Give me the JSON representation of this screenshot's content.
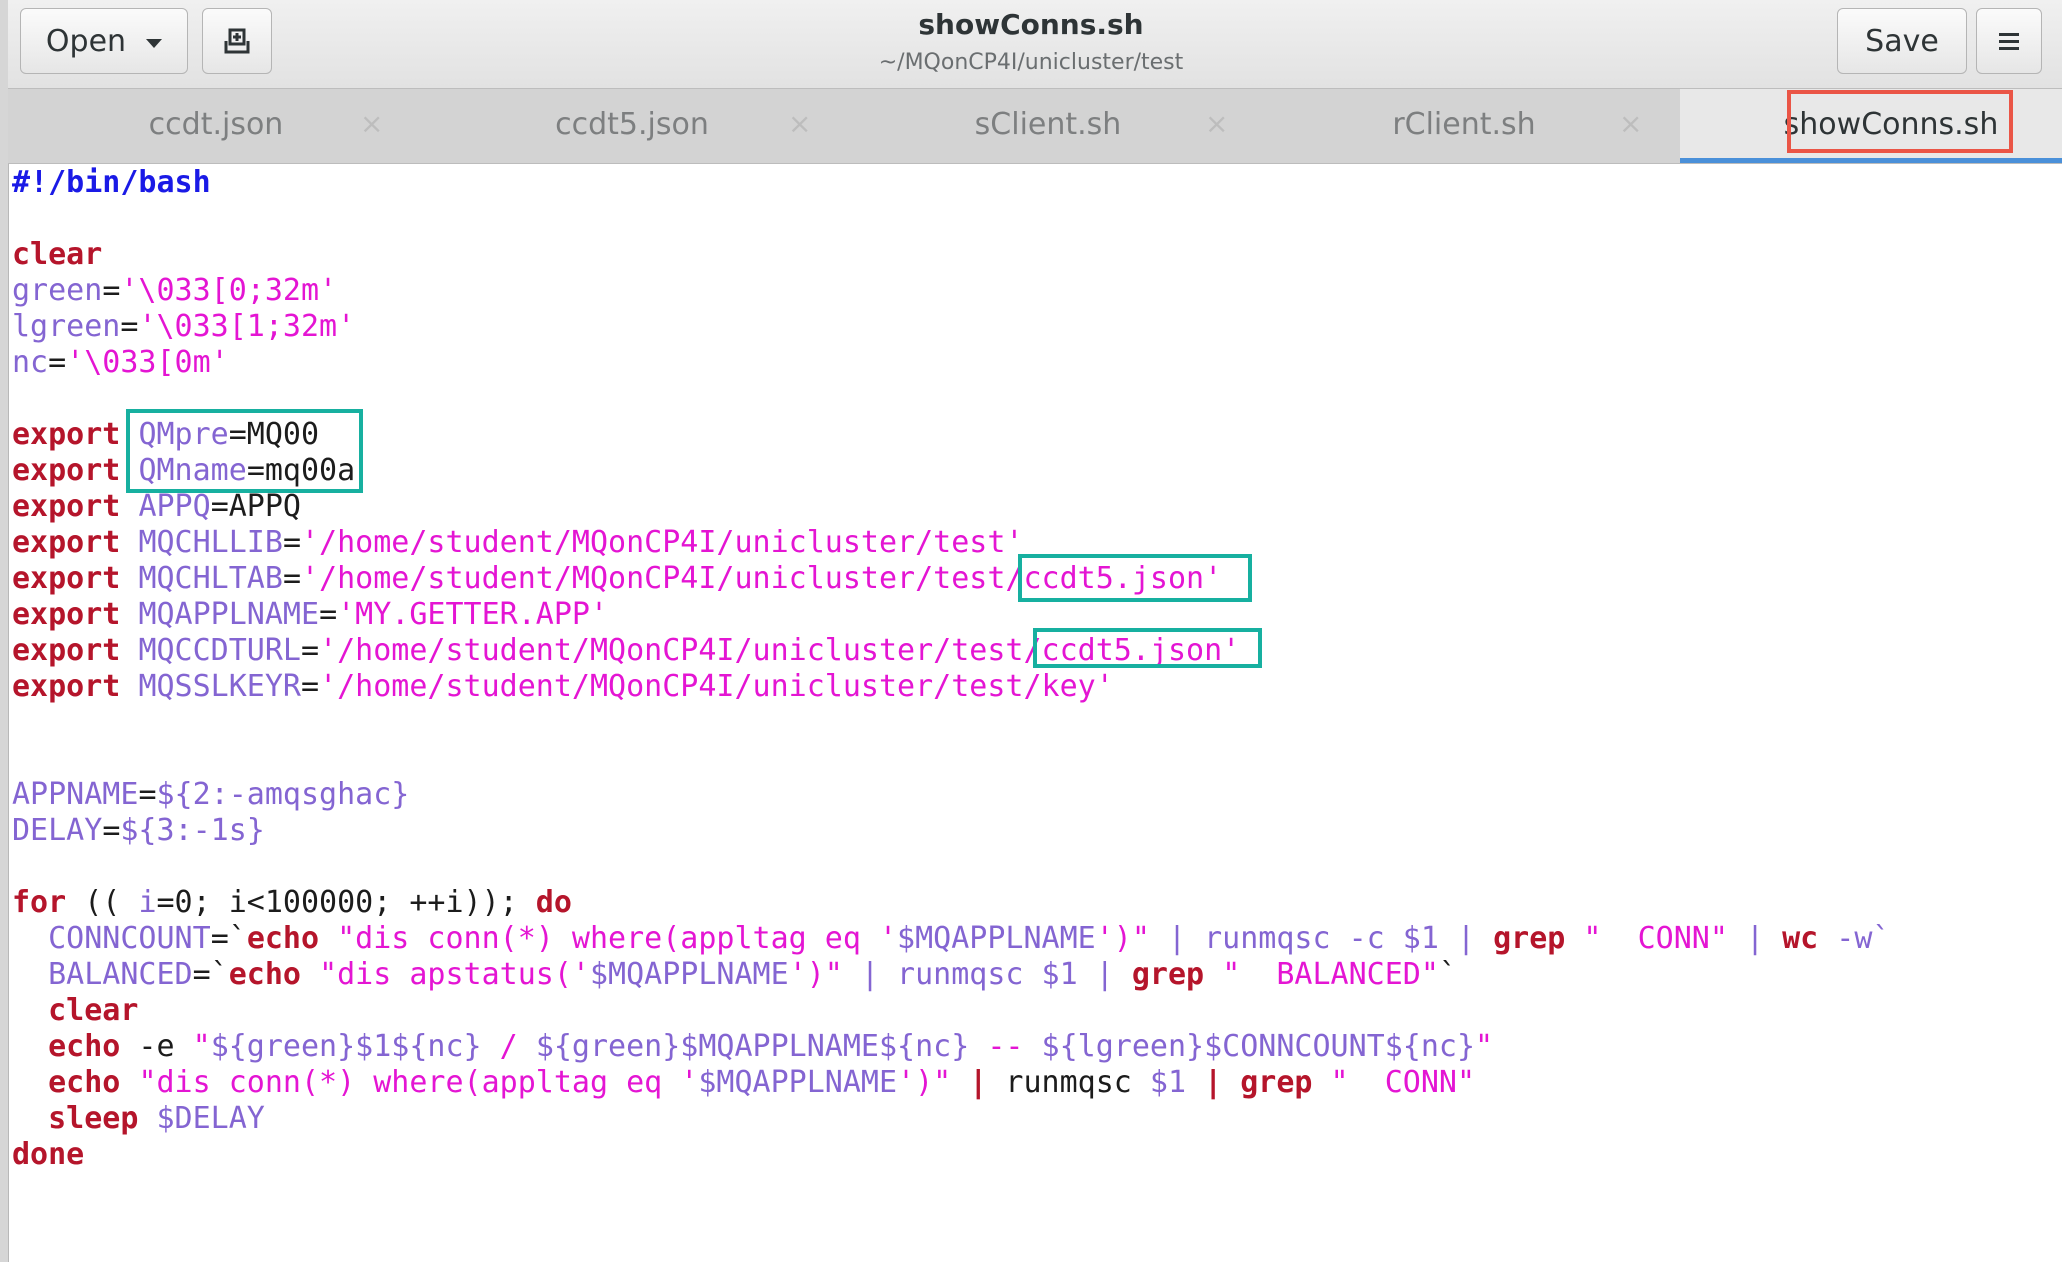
{
  "window": {
    "title": "showConns.sh",
    "path": "~/MQonCP4I/unicluster/test"
  },
  "toolbar": {
    "open_label": "Open",
    "save_label": "Save"
  },
  "tabs": [
    {
      "label": "ccdt.json",
      "close": "×"
    },
    {
      "label": "ccdt5.json",
      "close": "×"
    },
    {
      "label": "sClient.sh",
      "close": "×"
    },
    {
      "label": "rClient.sh",
      "close": "×"
    },
    {
      "label": "showConns.sh"
    }
  ],
  "editor": {
    "lines": [
      [
        [
          "sh",
          "#!/bin/bash"
        ]
      ],
      [],
      [
        [
          "kw",
          "clear"
        ]
      ],
      [
        [
          "var",
          "green"
        ],
        [
          "p",
          "="
        ],
        [
          "str",
          "'\\033[0;32m'"
        ]
      ],
      [
        [
          "var",
          "lgreen"
        ],
        [
          "p",
          "="
        ],
        [
          "str",
          "'\\033[1;32m'"
        ]
      ],
      [
        [
          "var",
          "nc"
        ],
        [
          "p",
          "="
        ],
        [
          "str",
          "'\\033[0m'"
        ]
      ],
      [],
      [
        [
          "kw",
          "export"
        ],
        [
          "p",
          " "
        ],
        [
          "var",
          "QMpre"
        ],
        [
          "p",
          "=MQ00"
        ]
      ],
      [
        [
          "kw",
          "export"
        ],
        [
          "p",
          " "
        ],
        [
          "var",
          "QMname"
        ],
        [
          "p",
          "=mq00a"
        ]
      ],
      [
        [
          "kw",
          "export"
        ],
        [
          "p",
          " "
        ],
        [
          "var",
          "APPQ"
        ],
        [
          "p",
          "=APPQ"
        ]
      ],
      [
        [
          "kw",
          "export"
        ],
        [
          "p",
          " "
        ],
        [
          "var",
          "MQCHLLIB"
        ],
        [
          "p",
          "="
        ],
        [
          "str",
          "'/home/student/MQonCP4I/unicluster/test'"
        ]
      ],
      [
        [
          "kw",
          "export"
        ],
        [
          "p",
          " "
        ],
        [
          "var",
          "MQCHLTAB"
        ],
        [
          "p",
          "="
        ],
        [
          "str",
          "'/home/student/MQonCP4I/unicluster/test/ccdt5.json'"
        ]
      ],
      [
        [
          "kw",
          "export"
        ],
        [
          "p",
          " "
        ],
        [
          "var",
          "MQAPPLNAME"
        ],
        [
          "p",
          "="
        ],
        [
          "str",
          "'MY.GETTER.APP'"
        ]
      ],
      [
        [
          "kw",
          "export"
        ],
        [
          "p",
          " "
        ],
        [
          "var",
          "MQCCDTURL"
        ],
        [
          "p",
          "="
        ],
        [
          "str",
          "'/home/student/MQonCP4I/unicluster/test/ccdt5.json'"
        ]
      ],
      [
        [
          "kw",
          "export"
        ],
        [
          "p",
          " "
        ],
        [
          "var",
          "MQSSLKEYR"
        ],
        [
          "p",
          "="
        ],
        [
          "str",
          "'/home/student/MQonCP4I/unicluster/test/key'"
        ]
      ],
      [],
      [],
      [
        [
          "var",
          "APPNAME"
        ],
        [
          "p",
          "="
        ],
        [
          "var",
          "${2:-amqsghac}"
        ]
      ],
      [
        [
          "var",
          "DELAY"
        ],
        [
          "p",
          "="
        ],
        [
          "var",
          "${3:-1s}"
        ]
      ],
      [],
      [
        [
          "kw",
          "for"
        ],
        [
          "p",
          " (( "
        ],
        [
          "var",
          "i"
        ],
        [
          "p",
          "=0; i<100000; ++i)); "
        ],
        [
          "kw",
          "do"
        ]
      ],
      [
        [
          "p",
          "  "
        ],
        [
          "var",
          "CONNCOUNT"
        ],
        [
          "p",
          "=`"
        ],
        [
          "kw",
          "echo"
        ],
        [
          "p",
          " "
        ],
        [
          "str",
          "\"dis conn(*) where(appltag eq '"
        ],
        [
          "var",
          "$MQAPPLNAME"
        ],
        [
          "str",
          "')\""
        ],
        [
          "p",
          " "
        ],
        [
          "var",
          "| runmqsc -c $1 |"
        ],
        [
          "p",
          " "
        ],
        [
          "kw",
          "grep"
        ],
        [
          "p",
          " "
        ],
        [
          "str",
          "\"  CONN\""
        ],
        [
          "p",
          " "
        ],
        [
          "var",
          "|"
        ],
        [
          "p",
          " "
        ],
        [
          "kw",
          "wc"
        ],
        [
          "p",
          " "
        ],
        [
          "var",
          "-w`"
        ]
      ],
      [
        [
          "p",
          "  "
        ],
        [
          "var",
          "BALANCED"
        ],
        [
          "p",
          "=`"
        ],
        [
          "kw",
          "echo"
        ],
        [
          "p",
          " "
        ],
        [
          "str",
          "\"dis apstatus('"
        ],
        [
          "var",
          "$MQAPPLNAME"
        ],
        [
          "str",
          "')\""
        ],
        [
          "p",
          " "
        ],
        [
          "var",
          "| runmqsc $1 |"
        ],
        [
          "p",
          " "
        ],
        [
          "kw",
          "grep"
        ],
        [
          "p",
          " "
        ],
        [
          "str",
          "\"  BALANCED\""
        ],
        [
          "p",
          "`"
        ]
      ],
      [
        [
          "p",
          "  "
        ],
        [
          "kw",
          "clear"
        ]
      ],
      [
        [
          "p",
          "  "
        ],
        [
          "kw",
          "echo"
        ],
        [
          "p",
          " -e "
        ],
        [
          "str",
          "\""
        ],
        [
          "var",
          "${green}$1${nc}"
        ],
        [
          "str",
          " / "
        ],
        [
          "var",
          "${green}$MQAPPLNAME${nc}"
        ],
        [
          "str",
          " -- "
        ],
        [
          "var",
          "${lgreen}$CONNCOUNT${nc}"
        ],
        [
          "str",
          "\""
        ]
      ],
      [
        [
          "p",
          "  "
        ],
        [
          "kw",
          "echo"
        ],
        [
          "p",
          " "
        ],
        [
          "str",
          "\"dis conn(*) where(appltag eq '"
        ],
        [
          "var",
          "$MQAPPLNAME"
        ],
        [
          "str",
          "')\""
        ],
        [
          "p",
          " "
        ],
        [
          "kw",
          "|"
        ],
        [
          "p",
          " runmqsc "
        ],
        [
          "var",
          "$1"
        ],
        [
          "p",
          " "
        ],
        [
          "kw",
          "|"
        ],
        [
          "p",
          " "
        ],
        [
          "kw",
          "grep"
        ],
        [
          "p",
          " "
        ],
        [
          "str",
          "\"  CONN\""
        ]
      ],
      [
        [
          "p",
          "  "
        ],
        [
          "kw",
          "sleep"
        ],
        [
          "p",
          " "
        ],
        [
          "var",
          "$DELAY"
        ]
      ],
      [
        [
          "kw",
          "done"
        ]
      ]
    ]
  },
  "highlights": {
    "accent_red": "#ea5546",
    "accent_teal": "#17b0a0"
  },
  "colors": {
    "keyword": "#b5152b",
    "variable": "#8465d2",
    "string": "#e415d3",
    "shebang": "#1a1ae6",
    "tab_underline": "#4a90d9"
  }
}
